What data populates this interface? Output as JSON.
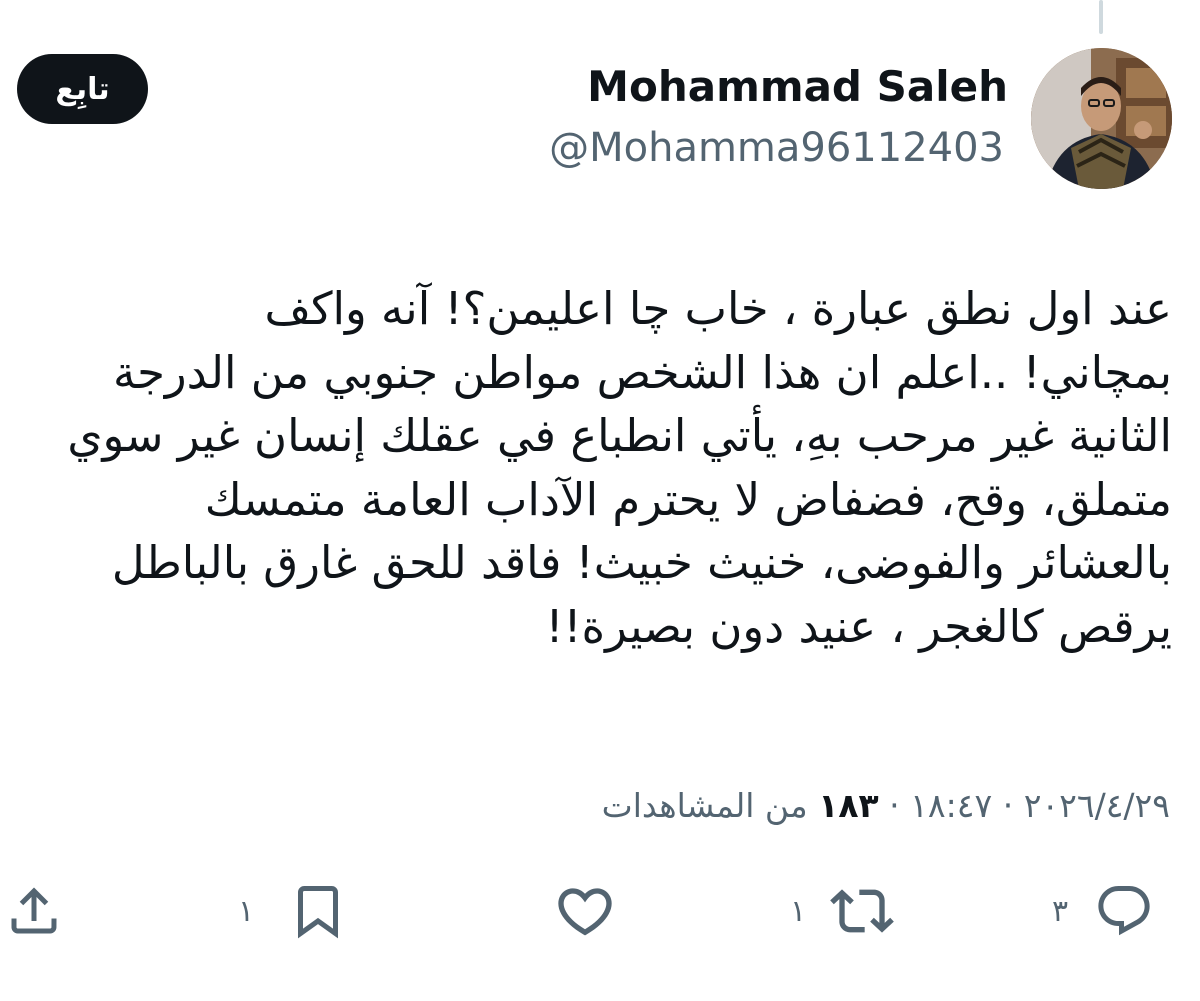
{
  "author": {
    "display_name": "Mohammad Saleh",
    "handle": "@Mohamma96112403"
  },
  "follow_button": {
    "label": "تابِع"
  },
  "tweet": {
    "lines": [
      "عند اول نطق عبارة ، خاب چا اعليمن؟! آنه واكف",
      "بمچاني! ..اعلم ان هذا الشخص مواطن جنوبي من الدرجة",
      "الثانية غير مرحب بهِ، يأتي انطباع في عقلك إنسان غير سوي",
      "متملق، وقح، فضفاض لا يحترم الآداب العامة متمسك",
      "بالعشائر والفوضى، خنيث خبيث! فاقد للحق غارق بالباطل",
      "يرقص كالغجر ، عنيد دون بصيرة!!"
    ]
  },
  "meta": {
    "date": "٢٠٢٦/٤/٢٩",
    "separator": "·",
    "time": "١٨:٤٧",
    "views_count": "١٨٣",
    "views_label": "من المشاهدات"
  },
  "actions": {
    "reply": {
      "icon": "reply-icon",
      "count": "٣"
    },
    "repost": {
      "icon": "repost-icon",
      "count": "١"
    },
    "like": {
      "icon": "heart-icon",
      "count": ""
    },
    "bookmark": {
      "icon": "bookmark-icon",
      "count": "١"
    },
    "share": {
      "icon": "share-icon"
    }
  },
  "colors": {
    "text_primary": "#0f1419",
    "text_secondary": "#536471",
    "button_bg": "#0f1419",
    "button_text": "#ffffff",
    "background": "#ffffff"
  }
}
